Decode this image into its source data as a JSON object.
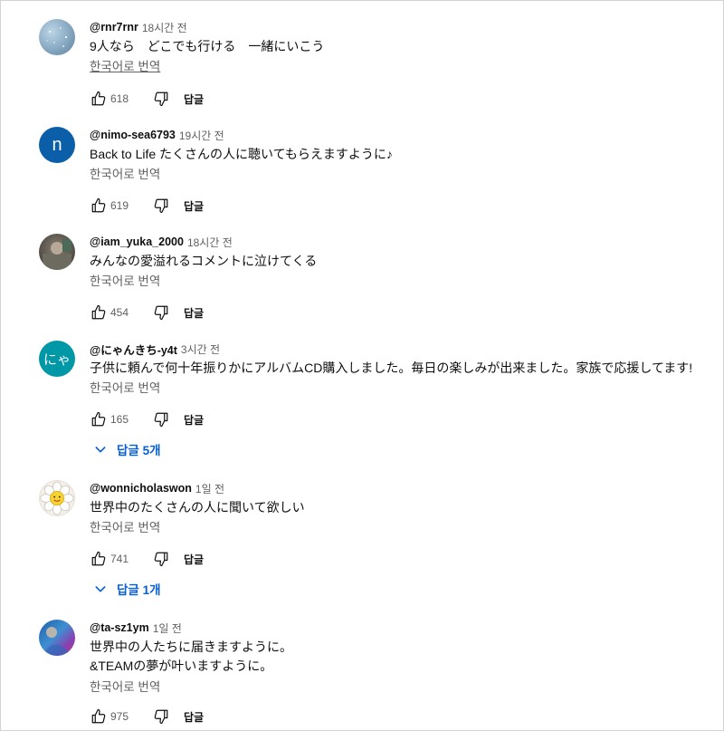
{
  "colors": {
    "link_blue": "#065fd4",
    "secondary_text": "#606060"
  },
  "comments": [
    {
      "author": "@rnr7rnr",
      "time": "18시간 전",
      "text": "9人なら　どこでも行ける　一緒にいこう",
      "translate": "한국어로 번역",
      "likes": "618",
      "reply": "답글"
    },
    {
      "author": "@nimo-sea6793",
      "time": "19시간 전",
      "text": "Back to Life たくさんの人に聴いてもらえますように♪",
      "translate": "한국어로 번역",
      "likes": "619",
      "reply": "답글",
      "avatar_letter": "n"
    },
    {
      "author": "@iam_yuka_2000",
      "time": "18시간 전",
      "text": "みんなの愛溢れるコメントに泣けてくる",
      "translate": "한국어로 번역",
      "likes": "454",
      "reply": "답글"
    },
    {
      "author": "@にゃんきち-y4t",
      "time": "3시간 전",
      "text": "子供に頼んで何十年振りかにアルバムCD購入しました。毎日の楽しみが出来ました。家族で応援してます!",
      "translate": "한국어로 번역",
      "likes": "165",
      "reply": "답글",
      "avatar_letter": "にゃ",
      "replies_label": "답글 5개"
    },
    {
      "author": "@wonnicholaswon",
      "time": "1일 전",
      "text": "世界中のたくさんの人に聞いて欲しい",
      "translate": "한국어로 번역",
      "likes": "741",
      "reply": "답글",
      "replies_label": "답글 1개"
    },
    {
      "author": "@ta-sz1ym",
      "time": "1일 전",
      "text": "世界中の人たちに届きますように。\n&TEAMの夢が叶いますように。",
      "translate": "한국어로 번역",
      "likes": "975",
      "reply": "답글"
    }
  ]
}
